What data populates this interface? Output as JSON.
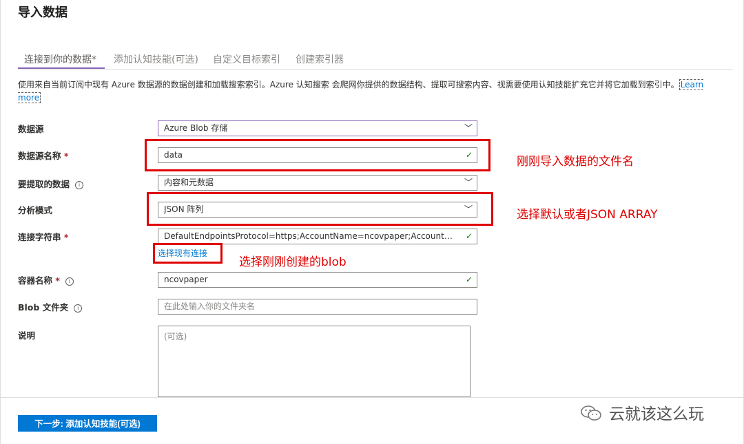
{
  "page_title": "导入数据",
  "tabs": [
    {
      "label": "连接到你的数据",
      "required": "*",
      "active": true
    },
    {
      "label": "添加认知技能(可选)",
      "active": false
    },
    {
      "label": "自定义目标索引",
      "active": false
    },
    {
      "label": "创建索引器",
      "active": false
    }
  ],
  "description": {
    "text": "使用来自当前订阅中现有 Azure 数据源的数据创建和加载搜索索引。Azure 认知搜索 会爬网你提供的数据结构、提取可搜索内容、视需要使用认知技能扩充它并将它加载到索引中。",
    "learn_more": "Learn more"
  },
  "form": {
    "data_source": {
      "label": "数据源",
      "value": "Azure Blob 存储"
    },
    "data_source_name": {
      "label": "数据源名称",
      "required": "*",
      "value": "data"
    },
    "data_to_extract": {
      "label": "要提取的数据",
      "value": "内容和元数据"
    },
    "parsing_mode": {
      "label": "分析模式",
      "value": "JSON 阵列"
    },
    "connection_string": {
      "label": "连接字符串",
      "required": "*",
      "value": "DefaultEndpointsProtocol=https;AccountName=ncovpaper;AccountKey ...",
      "choose_existing": "选择现有连接"
    },
    "container_name": {
      "label": "容器名称",
      "required": "*",
      "value": "ncovpaper"
    },
    "blob_folder": {
      "label": "Blob 文件夹",
      "placeholder": "在此处输入你的文件夹名"
    },
    "description": {
      "label": "说明",
      "placeholder": "(可选)"
    }
  },
  "annotations": {
    "name_note": "刚刚导入数据的文件名",
    "mode_note": "选择默认或者JSON ARRAY",
    "connection_note": "选择刚刚创建的blob"
  },
  "next_button": "下一步: 添加认知技能(可选)",
  "watermark": "云就该这么玩",
  "icons": {
    "dropdown": "chevron-down-icon",
    "valid": "checkmark-icon",
    "info": "info-icon"
  },
  "colors": {
    "accent": "#8764b8",
    "primary": "#0078d4",
    "annotation": "#e00000",
    "valid": "#107c10"
  }
}
